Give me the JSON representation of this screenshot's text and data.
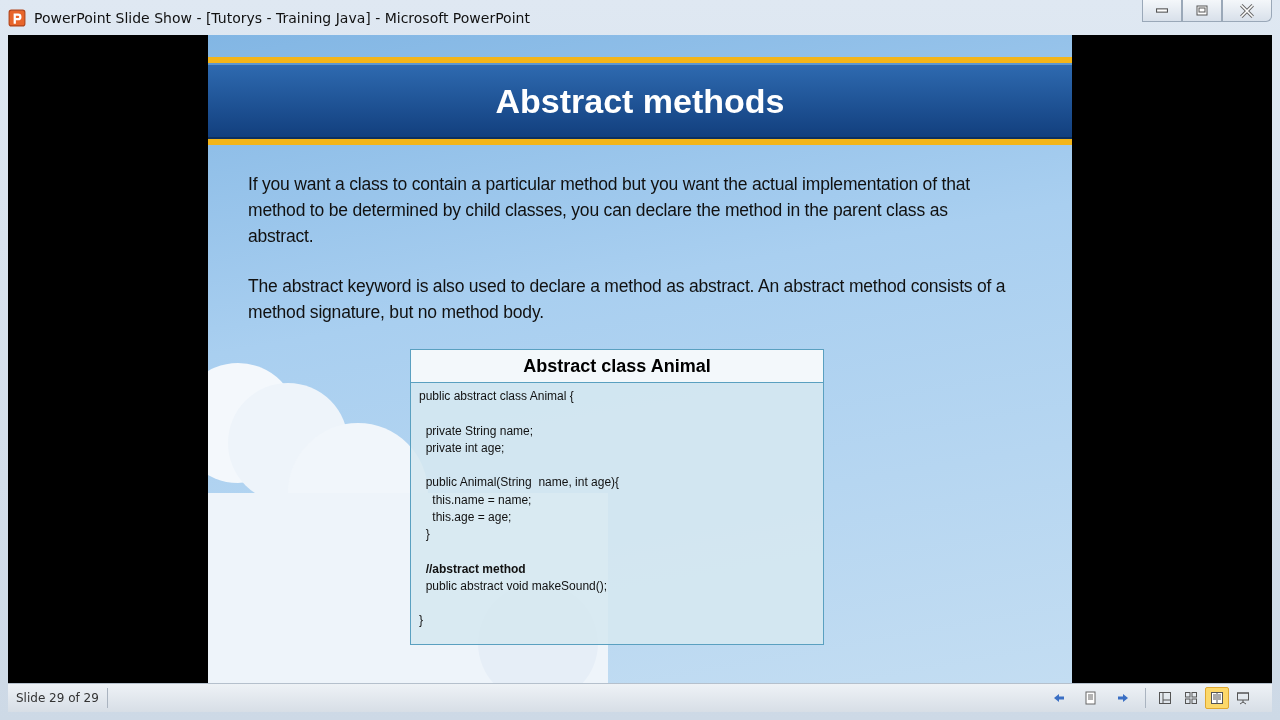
{
  "window": {
    "title": "PowerPoint Slide Show - [Tutorys - Training Java] - Microsoft PowerPoint"
  },
  "slide": {
    "title": "Abstract methods",
    "paragraphs": [
      "If you want a class to contain a particular method but you want the actual implementation of that method to be determined by child classes, you can declare the method in the parent class as abstract.",
      "The abstract keyword is also used to declare a method as abstract. An abstract method consists of a method signature, but no method body."
    ],
    "code_box": {
      "title": "Abstract class Animal",
      "blocks": [
        [
          {
            "text": "public abstract class Animal {",
            "bold": false
          }
        ],
        [
          {
            "text": "  private String name;",
            "bold": false
          },
          {
            "text": "  private int age;",
            "bold": false
          }
        ],
        [
          {
            "text": "  public Animal(String  name, int age){",
            "bold": false
          },
          {
            "text": "    this.name = name;",
            "bold": false
          },
          {
            "text": "    this.age = age;",
            "bold": false
          },
          {
            "text": "  }",
            "bold": false
          }
        ],
        [
          {
            "text": "  //abstract method",
            "bold": true
          },
          {
            "text": "  public abstract void makeSound();",
            "bold": false
          }
        ],
        [
          {
            "text": "}",
            "bold": false
          }
        ]
      ]
    }
  },
  "status_bar": {
    "slide_indicator": "Slide 29 of 29",
    "views": [
      {
        "kind": "normal",
        "selected": false
      },
      {
        "kind": "sorter",
        "selected": false
      },
      {
        "kind": "reading",
        "selected": true
      },
      {
        "kind": "show",
        "selected": false
      }
    ]
  }
}
